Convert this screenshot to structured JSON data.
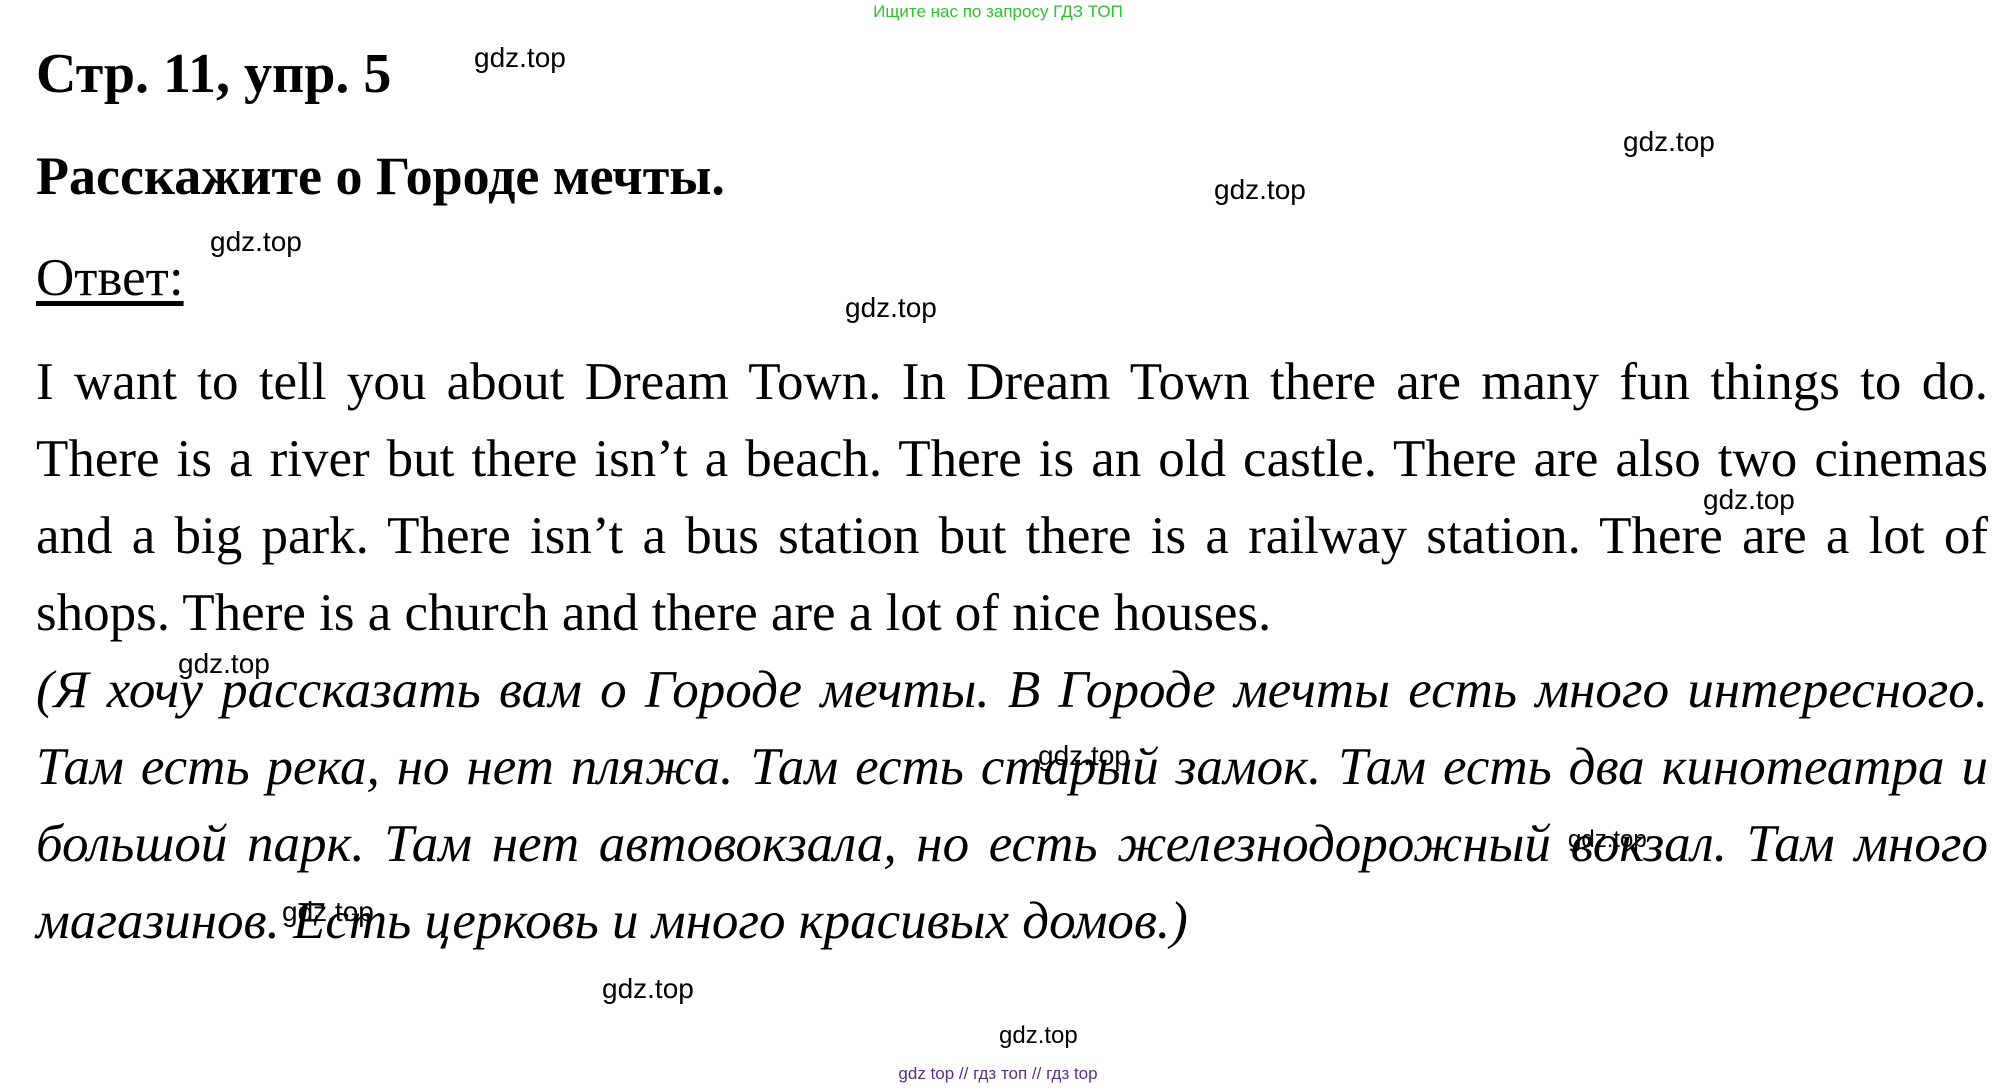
{
  "banner": "Ищите нас по запросу ГДЗ ТОП",
  "heading": {
    "title": "Стр. 11, упр. 5",
    "task": "Расскажите о Городе мечты.",
    "answer_label": "Ответ:"
  },
  "content": {
    "english": "I want to tell you about Dream Town. In Dream Town there are many fun things to do. There is a river but there isn’t a beach. There is an old castle. There are also two cinemas and a big park. There isn’t a bus station but there is a railway station. There are a lot of shops. There is a church and there are a lot of nice houses.",
    "russian": "(Я хочу рассказать вам о Городе мечты. В Городе мечты есть много интересного. Там есть река, но нет пляжа. Там есть старый замок. Там есть два кинотеатра и большой парк. Там нет автовокзала, но есть железнодорожный вокзал. Там много магазинов. Есть церковь и много красивых домов.)"
  },
  "watermarks": {
    "w1": "gdz.top",
    "w2": "gdz.top",
    "w3": "gdz.top",
    "w4": "gdz.top",
    "w5": "gdz.top",
    "w6": "gdz.top",
    "w7": "gdz.top",
    "w8": "gdz.top",
    "w9": "gdz.top",
    "w10": "gdz.top",
    "w11": "gdz.top",
    "w12": "gdz.top"
  },
  "footer": "gdz top  //  гдз топ  //  гдз top",
  "colors": {
    "banner": "#2fc12f",
    "footer": "#5a2f86",
    "text": "#000000"
  }
}
